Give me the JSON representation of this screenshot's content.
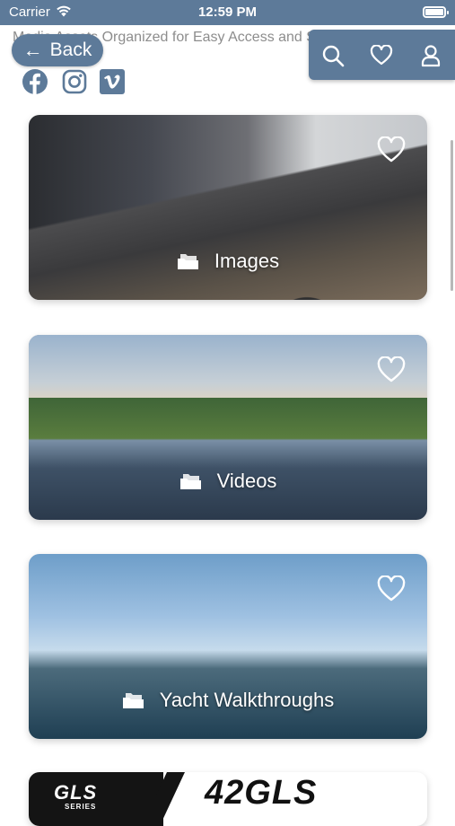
{
  "status_bar": {
    "carrier": "Carrier",
    "time": "12:59 PM"
  },
  "header": {
    "subtitle": "Media Assets Organized for Easy Access and Sharing",
    "back_label": "Back",
    "toolbar_icons": [
      "search-icon",
      "heart-icon",
      "user-icon"
    ],
    "social_icons": [
      "facebook-icon",
      "instagram-icon",
      "vimeo-icon"
    ]
  },
  "cards": [
    {
      "label": "Images"
    },
    {
      "label": "Videos"
    },
    {
      "label": "Yacht Walkthroughs"
    }
  ],
  "partial_card": {
    "series_text": "GLS",
    "series_caption": "SERIES",
    "model_text": "42GLS"
  },
  "colors": {
    "brand": "#5d7a99",
    "background": "#ffffff",
    "subtitle_text": "#8d8d8d"
  }
}
